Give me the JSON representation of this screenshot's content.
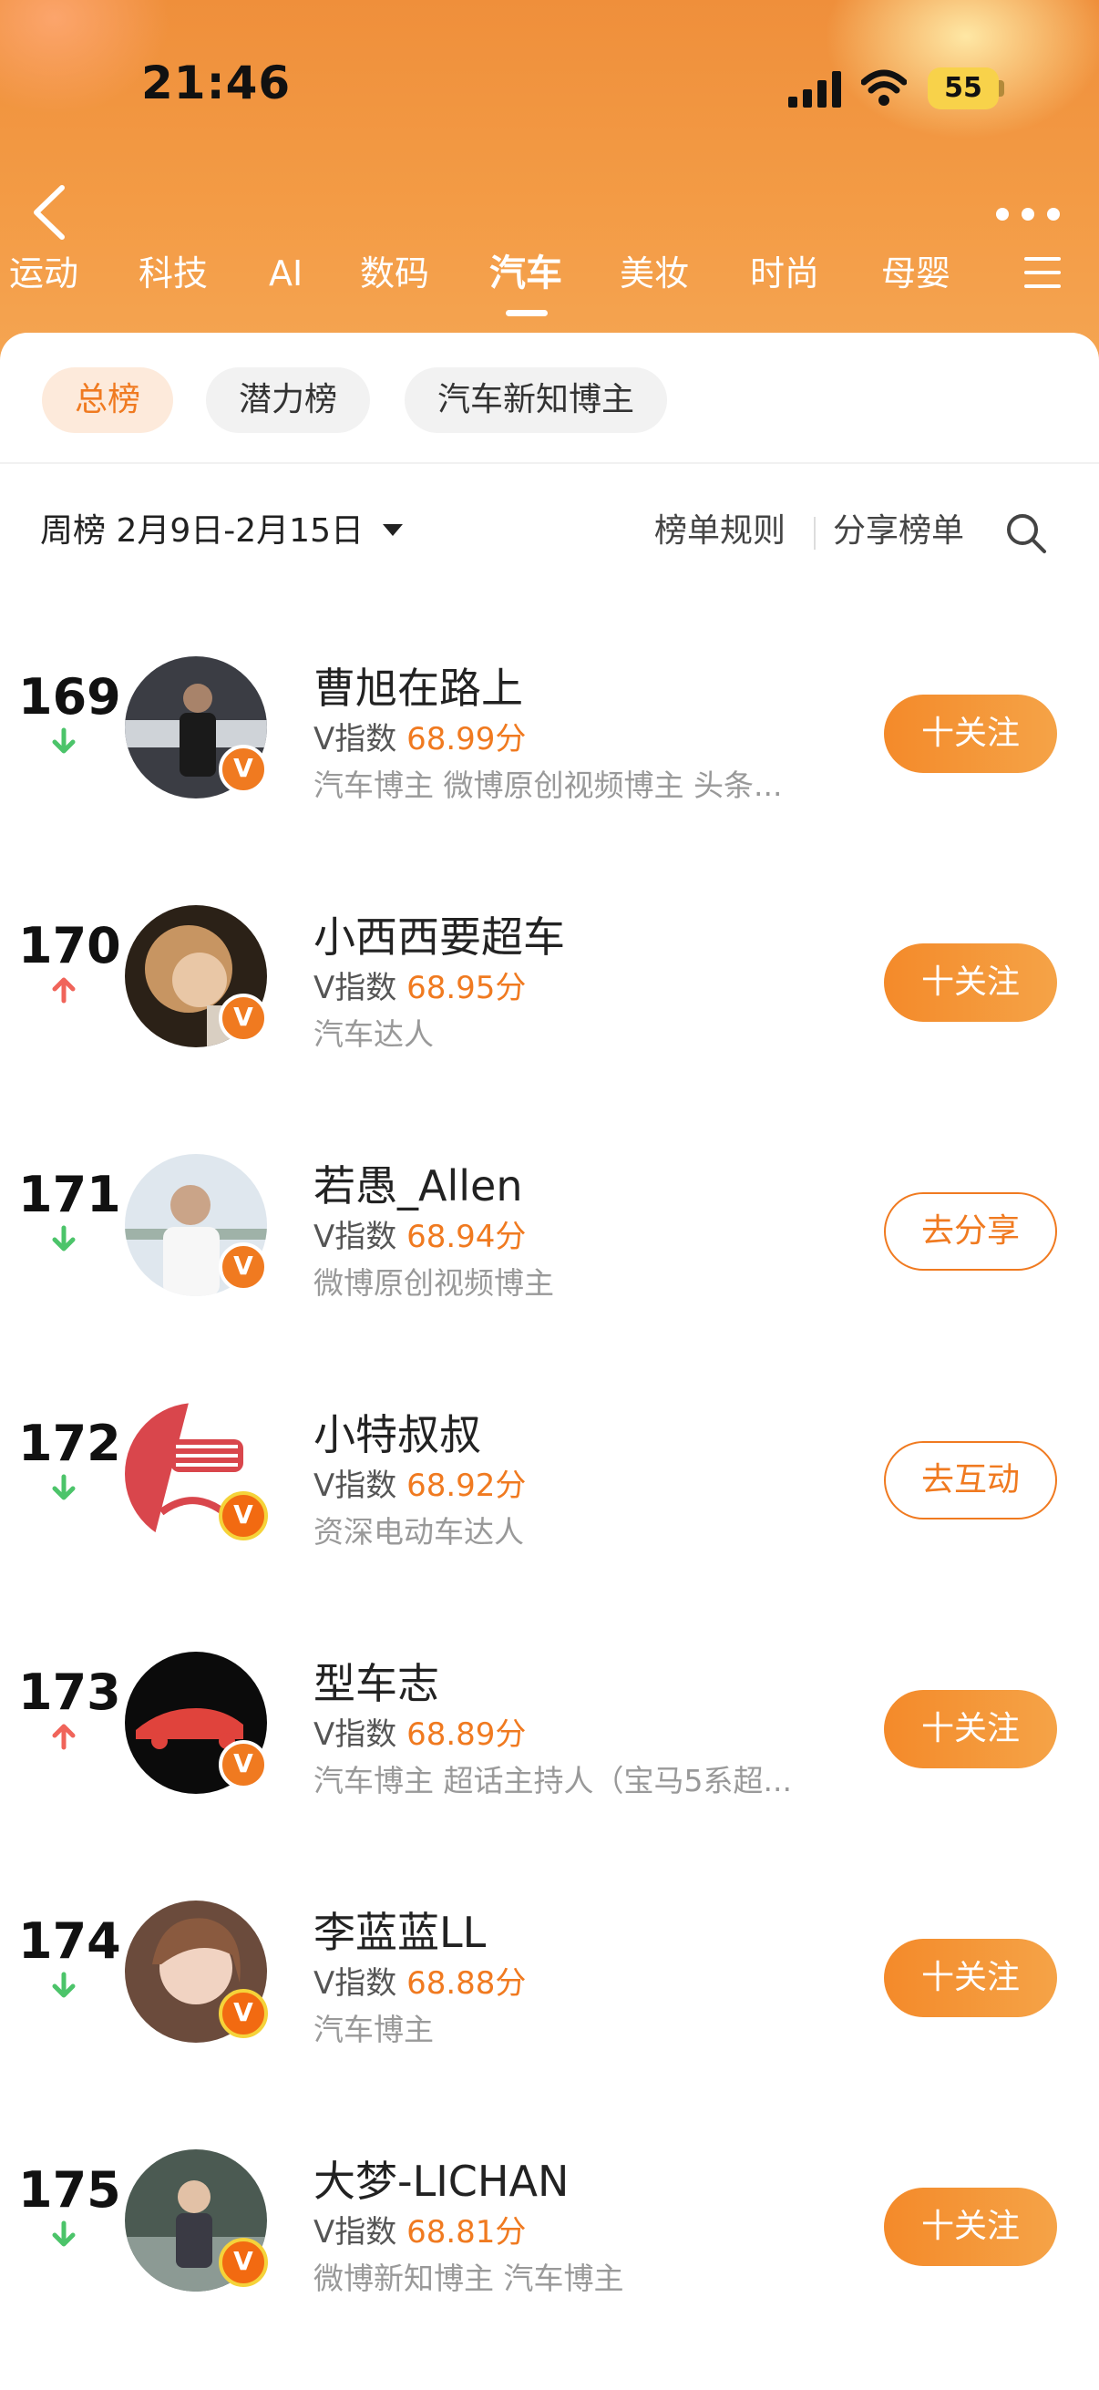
{
  "status_bar": {
    "time": "21:46",
    "battery": "55"
  },
  "tabs": [
    "运动",
    "科技",
    "AI",
    "数码",
    "汽车",
    "美妆",
    "时尚",
    "母婴"
  ],
  "active_tab": "汽车",
  "chips": [
    "总榜",
    "潜力榜",
    "汽车新知博主"
  ],
  "filter": {
    "period_label": "周榜",
    "period_range": "2月9日-2月15日",
    "rules": "榜单规则",
    "share": "分享榜单"
  },
  "colors": {
    "accent": "#f07a20",
    "trend_up": "#f0645a",
    "trend_down": "#4cc46a"
  },
  "entries": [
    {
      "rank": "169",
      "trend": "down",
      "name": "曹旭在路上",
      "vindex_label": "V指数",
      "score": "68.99分",
      "desc": "汽车博主 微博原创视频博主 头条...",
      "button": "十关注",
      "button_type": "follow"
    },
    {
      "rank": "170",
      "trend": "up",
      "name": "小西西要超车",
      "vindex_label": "V指数",
      "score": "68.95分",
      "desc": "汽车达人",
      "button": "十关注",
      "button_type": "follow"
    },
    {
      "rank": "171",
      "trend": "down",
      "name": "若愚_Allen",
      "vindex_label": "V指数",
      "score": "68.94分",
      "desc": "微博原创视频博主",
      "button": "去分享",
      "button_type": "outline"
    },
    {
      "rank": "172",
      "trend": "down",
      "name": "小特叔叔",
      "vindex_label": "V指数",
      "score": "68.92分",
      "desc": "资深电动车达人",
      "button": "去互动",
      "button_type": "outline"
    },
    {
      "rank": "173",
      "trend": "up",
      "name": "型车志",
      "vindex_label": "V指数",
      "score": "68.89分",
      "desc": "汽车博主 超话主持人（宝马5系超...",
      "button": "十关注",
      "button_type": "follow"
    },
    {
      "rank": "174",
      "trend": "down",
      "name": "李蓝蓝LL",
      "vindex_label": "V指数",
      "score": "68.88分",
      "desc": "汽车博主",
      "button": "十关注",
      "button_type": "follow"
    },
    {
      "rank": "175",
      "trend": "down",
      "name": "大梦-LICHAN",
      "vindex_label": "V指数",
      "score": "68.81分",
      "desc": "微博新知博主 汽车博主",
      "button": "十关注",
      "button_type": "follow"
    }
  ]
}
